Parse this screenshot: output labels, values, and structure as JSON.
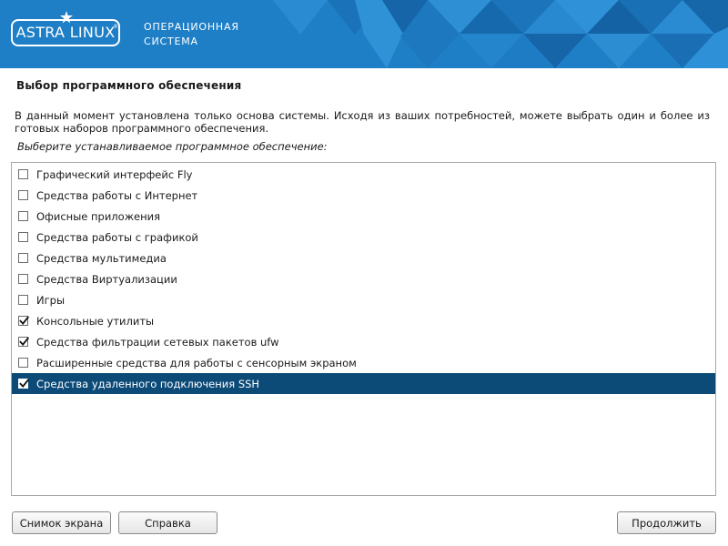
{
  "banner": {
    "logo_text": "ASTRA LINUX",
    "logo_reg": "®",
    "subtitle_line1": "ОПЕРАЦИОННАЯ",
    "subtitle_line2": "СИСТЕМА",
    "colors": {
      "background": "#1e7fc7",
      "pattern_dark": "#1565a8",
      "pattern_light": "#2f91d6"
    }
  },
  "page": {
    "title": "Выбор программного обеспечения",
    "description": "В данный момент установлена только основа системы. Исходя из ваших потребностей, можете выбрать один и более из готовых наборов программного обеспечения.",
    "prompt": "Выберите устанавливаемое программное обеспечение:"
  },
  "software_list": {
    "selection_color": "#0c4a78",
    "items": [
      {
        "label": "Графический интерфейс Fly",
        "checked": false,
        "selected": false
      },
      {
        "label": "Средства работы с Интернет",
        "checked": false,
        "selected": false
      },
      {
        "label": "Офисные приложения",
        "checked": false,
        "selected": false
      },
      {
        "label": "Средства работы с графикой",
        "checked": false,
        "selected": false
      },
      {
        "label": "Средства мультимедиа",
        "checked": false,
        "selected": false
      },
      {
        "label": "Средства Виртуализации",
        "checked": false,
        "selected": false
      },
      {
        "label": "Игры",
        "checked": false,
        "selected": false
      },
      {
        "label": "Консольные утилиты",
        "checked": true,
        "selected": false
      },
      {
        "label": "Средства фильтрации сетевых пакетов ufw",
        "checked": true,
        "selected": false
      },
      {
        "label": "Расширенные средства для работы с сенсорным экраном",
        "checked": false,
        "selected": false
      },
      {
        "label": "Средства удаленного подключения SSH",
        "checked": true,
        "selected": true
      }
    ]
  },
  "buttons": {
    "screenshot": "Снимок экрана",
    "help": "Справка",
    "continue": "Продолжить"
  }
}
